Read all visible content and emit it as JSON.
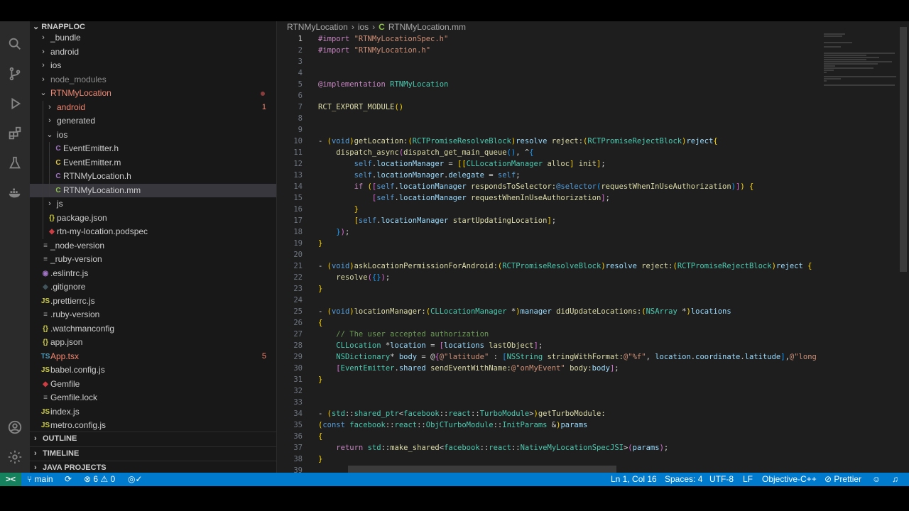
{
  "explorer": {
    "root": "RNAPPLOC",
    "items": [
      {
        "label": "_bundle",
        "depth": 1,
        "chevron": "›",
        "icon": "",
        "color": "#cccccc"
      },
      {
        "label": "android",
        "depth": 1,
        "chevron": "›",
        "icon": "",
        "color": "#cccccc"
      },
      {
        "label": "ios",
        "depth": 1,
        "chevron": "›",
        "icon": "",
        "color": "#cccccc"
      },
      {
        "label": "node_modules",
        "depth": 1,
        "chevron": "›",
        "icon": "",
        "color": "#8c8c8c"
      },
      {
        "label": "RTNMyLocation",
        "depth": 1,
        "chevron": "⌄",
        "icon": "",
        "color": "#f48771",
        "dot": true
      },
      {
        "label": "android",
        "depth": 2,
        "chevron": "›",
        "icon": "",
        "color": "#f48771",
        "badge": "1"
      },
      {
        "label": "generated",
        "depth": 2,
        "chevron": "›",
        "icon": "",
        "color": "#cccccc"
      },
      {
        "label": "ios",
        "depth": 2,
        "chevron": "⌄",
        "icon": "",
        "color": "#cccccc"
      },
      {
        "label": "EventEmitter.h",
        "depth": 3,
        "chevron": "",
        "icon": "C",
        "iconColor": "#a074c4",
        "color": "#cccccc"
      },
      {
        "label": "EventEmitter.m",
        "depth": 3,
        "chevron": "",
        "icon": "C",
        "iconColor": "#e0c64a",
        "color": "#cccccc"
      },
      {
        "label": "RTNMyLocation.h",
        "depth": 3,
        "chevron": "",
        "icon": "C",
        "iconColor": "#a074c4",
        "color": "#cccccc"
      },
      {
        "label": "RTNMyLocation.mm",
        "depth": 3,
        "chevron": "",
        "icon": "C",
        "iconColor": "#8dc149",
        "color": "#cccccc",
        "selected": true
      },
      {
        "label": "js",
        "depth": 2,
        "chevron": "›",
        "icon": "",
        "color": "#cccccc"
      },
      {
        "label": "package.json",
        "depth": 2,
        "chevron": "",
        "icon": "{}",
        "iconColor": "#cbcb41",
        "color": "#cccccc"
      },
      {
        "label": "rtn-my-location.podspec",
        "depth": 2,
        "chevron": "",
        "icon": "◆",
        "iconColor": "#cc3e44",
        "color": "#cccccc"
      },
      {
        "label": "_node-version",
        "depth": 1,
        "chevron": "",
        "icon": "≡",
        "iconColor": "#9a9a9a",
        "color": "#cccccc"
      },
      {
        "label": "_ruby-version",
        "depth": 1,
        "chevron": "",
        "icon": "≡",
        "iconColor": "#9a9a9a",
        "color": "#cccccc"
      },
      {
        "label": ".eslintrc.js",
        "depth": 1,
        "chevron": "",
        "icon": "◉",
        "iconColor": "#a074c4",
        "color": "#cccccc"
      },
      {
        "label": ".gitignore",
        "depth": 1,
        "chevron": "",
        "icon": "◆",
        "iconColor": "#41535b",
        "color": "#cccccc"
      },
      {
        "label": ".prettierrc.js",
        "depth": 1,
        "chevron": "",
        "icon": "JS",
        "iconColor": "#cbcb41",
        "color": "#cccccc"
      },
      {
        "label": ".ruby-version",
        "depth": 1,
        "chevron": "",
        "icon": "≡",
        "iconColor": "#9a9a9a",
        "color": "#cccccc"
      },
      {
        "label": ".watchmanconfig",
        "depth": 1,
        "chevron": "",
        "icon": "{}",
        "iconColor": "#cbcb41",
        "color": "#cccccc"
      },
      {
        "label": "app.json",
        "depth": 1,
        "chevron": "",
        "icon": "{}",
        "iconColor": "#cbcb41",
        "color": "#cccccc"
      },
      {
        "label": "App.tsx",
        "depth": 1,
        "chevron": "",
        "icon": "TS",
        "iconColor": "#519aba",
        "color": "#f48771",
        "badge": "5"
      },
      {
        "label": "babel.config.js",
        "depth": 1,
        "chevron": "",
        "icon": "JS",
        "iconColor": "#cbcb41",
        "color": "#cccccc"
      },
      {
        "label": "Gemfile",
        "depth": 1,
        "chevron": "",
        "icon": "◆",
        "iconColor": "#cc3e44",
        "color": "#cccccc"
      },
      {
        "label": "Gemfile.lock",
        "depth": 1,
        "chevron": "",
        "icon": "≡",
        "iconColor": "#9a9a9a",
        "color": "#cccccc"
      },
      {
        "label": "index.js",
        "depth": 1,
        "chevron": "",
        "icon": "JS",
        "iconColor": "#cbcb41",
        "color": "#cccccc"
      },
      {
        "label": "metro.config.js",
        "depth": 1,
        "chevron": "",
        "icon": "JS",
        "iconColor": "#cbcb41",
        "color": "#cccccc"
      }
    ],
    "sections": [
      "OUTLINE",
      "TIMELINE",
      "JAVA PROJECTS"
    ]
  },
  "breadcrumb": {
    "parts": [
      "RTNMyLocation",
      "ios",
      "RTNMyLocation.mm"
    ],
    "file_icon": "C"
  },
  "code": {
    "active_line": 1,
    "lines": [
      [
        [
          "kw",
          "#import "
        ],
        [
          "st",
          "\"RTNMyLocationSpec.h\""
        ]
      ],
      [
        [
          "kw",
          "#import "
        ],
        [
          "st",
          "\"RTNMyLocation.h\""
        ]
      ],
      [],
      [],
      [
        [
          "kw",
          "@implementation "
        ],
        [
          "ty",
          "RTNMyLocation"
        ]
      ],
      [],
      [
        [
          "fn",
          "RCT_EXPORT_MODULE"
        ],
        [
          "br1",
          "()"
        ]
      ],
      [],
      [],
      [
        [
          "pl",
          "- "
        ],
        [
          "br1",
          "("
        ],
        [
          "bl",
          "void"
        ],
        [
          "br1",
          ")"
        ],
        [
          "fn",
          "getLocation:"
        ],
        [
          "br1",
          "("
        ],
        [
          "ty",
          "RCTPromiseResolveBlock"
        ],
        [
          "br1",
          ")"
        ],
        [
          "va",
          "resolve "
        ],
        [
          "fn",
          "reject:"
        ],
        [
          "br1",
          "("
        ],
        [
          "ty",
          "RCTPromiseRejectBlock"
        ],
        [
          "br1",
          ")"
        ],
        [
          "va",
          "reject"
        ],
        [
          "br1",
          "{"
        ]
      ],
      [
        [
          "pl",
          "    "
        ],
        [
          "fn",
          "dispatch_async"
        ],
        [
          "br2",
          "("
        ],
        [
          "fn",
          "dispatch_get_main_queue"
        ],
        [
          "br3",
          "()"
        ],
        [
          "pl",
          ", ^"
        ],
        [
          "br3",
          "{"
        ]
      ],
      [
        [
          "pl",
          "        "
        ],
        [
          "bl",
          "self"
        ],
        [
          "pl",
          "."
        ],
        [
          "va",
          "locationManager"
        ],
        [
          "pl",
          " = "
        ],
        [
          "br1",
          "[["
        ],
        [
          "ty",
          "CLLocationManager "
        ],
        [
          "fn",
          "alloc"
        ],
        [
          "br1",
          "] "
        ],
        [
          "fn",
          "init"
        ],
        [
          "br1",
          "]"
        ],
        [
          "pl",
          ";"
        ]
      ],
      [
        [
          "pl",
          "        "
        ],
        [
          "bl",
          "self"
        ],
        [
          "pl",
          "."
        ],
        [
          "va",
          "locationManager"
        ],
        [
          "pl",
          "."
        ],
        [
          "va",
          "delegate"
        ],
        [
          "pl",
          " = "
        ],
        [
          "bl",
          "self"
        ],
        [
          "pl",
          ";"
        ]
      ],
      [
        [
          "pl",
          "        "
        ],
        [
          "kw",
          "if "
        ],
        [
          "br1",
          "("
        ],
        [
          "br2",
          "["
        ],
        [
          "bl",
          "self"
        ],
        [
          "pl",
          "."
        ],
        [
          "va",
          "locationManager "
        ],
        [
          "fn",
          "respondsToSelector:"
        ],
        [
          "bl",
          "@selector"
        ],
        [
          "br3",
          "("
        ],
        [
          "fn",
          "requestWhenInUseAuthorization"
        ],
        [
          "br3",
          ")"
        ],
        [
          "br2",
          "]"
        ],
        [
          "br1",
          ")"
        ],
        [
          "pl",
          " "
        ],
        [
          "br1",
          "{"
        ]
      ],
      [
        [
          "pl",
          "            "
        ],
        [
          "br2",
          "["
        ],
        [
          "bl",
          "self"
        ],
        [
          "pl",
          "."
        ],
        [
          "va",
          "locationManager "
        ],
        [
          "fn",
          "requestWhenInUseAuthorization"
        ],
        [
          "br2",
          "]"
        ],
        [
          "pl",
          ";"
        ]
      ],
      [
        [
          "pl",
          "        "
        ],
        [
          "br1",
          "}"
        ]
      ],
      [
        [
          "pl",
          "        "
        ],
        [
          "br1",
          "["
        ],
        [
          "bl",
          "self"
        ],
        [
          "pl",
          "."
        ],
        [
          "va",
          "locationManager "
        ],
        [
          "fn",
          "startUpdatingLocation"
        ],
        [
          "br1",
          "]"
        ],
        [
          "pl",
          ";"
        ]
      ],
      [
        [
          "pl",
          "    "
        ],
        [
          "br3",
          "}"
        ],
        [
          "br2",
          ")"
        ],
        [
          "pl",
          ";"
        ]
      ],
      [
        [
          "br1",
          "}"
        ]
      ],
      [],
      [
        [
          "pl",
          "- "
        ],
        [
          "br1",
          "("
        ],
        [
          "bl",
          "void"
        ],
        [
          "br1",
          ")"
        ],
        [
          "fn",
          "askLocationPermissionForAndroid:"
        ],
        [
          "br1",
          "("
        ],
        [
          "ty",
          "RCTPromiseResolveBlock"
        ],
        [
          "br1",
          ")"
        ],
        [
          "va",
          "resolve "
        ],
        [
          "fn",
          "reject:"
        ],
        [
          "br1",
          "("
        ],
        [
          "ty",
          "RCTPromiseRejectBlock"
        ],
        [
          "br1",
          ")"
        ],
        [
          "va",
          "reject "
        ],
        [
          "br1",
          "{"
        ]
      ],
      [
        [
          "pl",
          "    "
        ],
        [
          "fn",
          "resolve"
        ],
        [
          "br2",
          "("
        ],
        [
          "br3",
          "{}"
        ],
        [
          "br2",
          ")"
        ],
        [
          "pl",
          ";"
        ]
      ],
      [
        [
          "br1",
          "}"
        ]
      ],
      [],
      [
        [
          "pl",
          "- "
        ],
        [
          "br1",
          "("
        ],
        [
          "bl",
          "void"
        ],
        [
          "br1",
          ")"
        ],
        [
          "fn",
          "locationManager:"
        ],
        [
          "br1",
          "("
        ],
        [
          "ty",
          "CLLocationManager "
        ],
        [
          "pl",
          "*"
        ],
        [
          "br1",
          ")"
        ],
        [
          "va",
          "manager "
        ],
        [
          "fn",
          "didUpdateLocations:"
        ],
        [
          "br1",
          "("
        ],
        [
          "ty",
          "NSArray "
        ],
        [
          "pl",
          "*"
        ],
        [
          "br1",
          ")"
        ],
        [
          "va",
          "locations"
        ]
      ],
      [
        [
          "br1",
          "{"
        ]
      ],
      [
        [
          "pl",
          "    "
        ],
        [
          "cm",
          "// The user accepted authorization"
        ]
      ],
      [
        [
          "pl",
          "    "
        ],
        [
          "ty",
          "CLLocation "
        ],
        [
          "pl",
          "*"
        ],
        [
          "va",
          "location"
        ],
        [
          "pl",
          " = "
        ],
        [
          "br2",
          "["
        ],
        [
          "va",
          "locations "
        ],
        [
          "fn",
          "lastObject"
        ],
        [
          "br2",
          "]"
        ],
        [
          "pl",
          ";"
        ]
      ],
      [
        [
          "pl",
          "    "
        ],
        [
          "ty",
          "NSDictionary"
        ],
        [
          "pl",
          "* "
        ],
        [
          "va",
          "body"
        ],
        [
          "pl",
          " = @"
        ],
        [
          "br2",
          "{"
        ],
        [
          "st",
          "@\"latitude\""
        ],
        [
          "pl",
          " : "
        ],
        [
          "br3",
          "["
        ],
        [
          "ty",
          "NSString "
        ],
        [
          "fn",
          "stringWithFormat:"
        ],
        [
          "st",
          "@\"%f\""
        ],
        [
          "pl",
          ", "
        ],
        [
          "va",
          "location"
        ],
        [
          "pl",
          "."
        ],
        [
          "va",
          "coordinate"
        ],
        [
          "pl",
          "."
        ],
        [
          "va",
          "latitude"
        ],
        [
          "br3",
          "]"
        ],
        [
          "pl",
          ","
        ],
        [
          "st",
          "@\"long"
        ]
      ],
      [
        [
          "pl",
          "    "
        ],
        [
          "br2",
          "["
        ],
        [
          "ty",
          "EventEmitter"
        ],
        [
          "pl",
          "."
        ],
        [
          "va",
          "shared "
        ],
        [
          "fn",
          "sendEventWithName:"
        ],
        [
          "st",
          "@\"onMyEvent\""
        ],
        [
          "pl",
          " "
        ],
        [
          "fn",
          "body:"
        ],
        [
          "va",
          "body"
        ],
        [
          "br2",
          "]"
        ],
        [
          "pl",
          ";"
        ]
      ],
      [
        [
          "br1",
          "}"
        ]
      ],
      [],
      [],
      [
        [
          "pl",
          "- "
        ],
        [
          "br1",
          "("
        ],
        [
          "ty",
          "std"
        ],
        [
          "pl",
          "::"
        ],
        [
          "ty",
          "shared_ptr"
        ],
        [
          "pl",
          "<"
        ],
        [
          "ty",
          "facebook"
        ],
        [
          "pl",
          "::"
        ],
        [
          "ty",
          "react"
        ],
        [
          "pl",
          "::"
        ],
        [
          "ty",
          "TurboModule"
        ],
        [
          "pl",
          ">"
        ],
        [
          "br1",
          ")"
        ],
        [
          "fn",
          "getTurboModule:"
        ]
      ],
      [
        [
          "br1",
          "("
        ],
        [
          "bl",
          "const "
        ],
        [
          "ty",
          "facebook"
        ],
        [
          "pl",
          "::"
        ],
        [
          "ty",
          "react"
        ],
        [
          "pl",
          "::"
        ],
        [
          "ty",
          "ObjCTurboModule"
        ],
        [
          "pl",
          "::"
        ],
        [
          "ty",
          "InitParams "
        ],
        [
          "pl",
          "&"
        ],
        [
          "br1",
          ")"
        ],
        [
          "va",
          "params"
        ]
      ],
      [
        [
          "br1",
          "{"
        ]
      ],
      [
        [
          "pl",
          "    "
        ],
        [
          "kw",
          "return "
        ],
        [
          "ty",
          "std"
        ],
        [
          "pl",
          "::"
        ],
        [
          "fn",
          "make_shared"
        ],
        [
          "pl",
          "<"
        ],
        [
          "ty",
          "facebook"
        ],
        [
          "pl",
          "::"
        ],
        [
          "ty",
          "react"
        ],
        [
          "pl",
          "::"
        ],
        [
          "ty",
          "NativeMyLocationSpecJSI"
        ],
        [
          "pl",
          ">"
        ],
        [
          "br2",
          "("
        ],
        [
          "va",
          "params"
        ],
        [
          "br2",
          ")"
        ],
        [
          "pl",
          ";"
        ]
      ],
      [
        [
          "br1",
          "}"
        ]
      ],
      []
    ]
  },
  "status": {
    "branch": "main",
    "errors": "6",
    "warnings": "0",
    "position": "Ln 1, Col 16",
    "spaces": "Spaces: 4",
    "encoding": "UTF-8",
    "eol": "LF",
    "language": "Objective-C++",
    "formatter": "Prettier",
    "remote_icon": "><",
    "sync_icon": "⟳",
    "accent": "#007acc",
    "remote_color": "#16825d"
  }
}
